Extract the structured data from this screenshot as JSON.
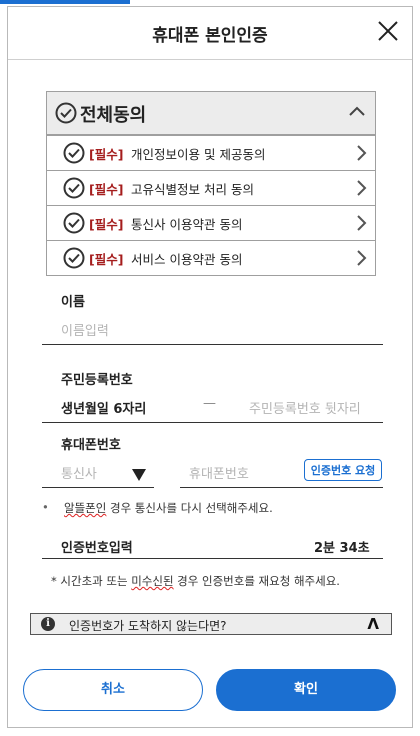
{
  "header": {
    "title": "휴대폰 본인인증"
  },
  "agreement": {
    "all_label": "전체동의",
    "items": [
      {
        "required": "[필수]",
        "label": "개인정보이용 및 제공동의"
      },
      {
        "required": "[필수]",
        "label": "고유식별정보 처리 동의"
      },
      {
        "required": "[필수]",
        "label": "통신사 이용약관 동의"
      },
      {
        "required": "[필수]",
        "label": "서비스 이용약관 동의"
      }
    ]
  },
  "name": {
    "label": "이름",
    "placeholder": "이름입력"
  },
  "rrn": {
    "label": "주민등록번호",
    "birth_label": "생년월일 6자리",
    "dash": "—",
    "back_placeholder": "주민등록번호 뒷자리"
  },
  "phone": {
    "label": "휴대폰번호",
    "carrier_placeholder": "통신사",
    "number_placeholder": "휴대폰번호",
    "request_button": "인증번호 요청",
    "note_bullet": "•",
    "note_underlined": "알뜰폰인",
    "note_rest": " 경우 통신사를 다시 선택해주세요."
  },
  "auth": {
    "label": "인증번호입력",
    "timer": "2분 34초",
    "note_prefix": "* 시간초과 또는 ",
    "note_underlined": "미수신된",
    "note_suffix": " 경우 인증번호를 재요청 해주세요."
  },
  "help": {
    "info_glyph": "i",
    "text": "인증번호가 도착하지 않는다면?",
    "toggle": "Λ"
  },
  "buttons": {
    "cancel": "취소",
    "confirm": "확인"
  },
  "colors": {
    "accent": "#1b6fd1",
    "required": "#a51d1d"
  }
}
